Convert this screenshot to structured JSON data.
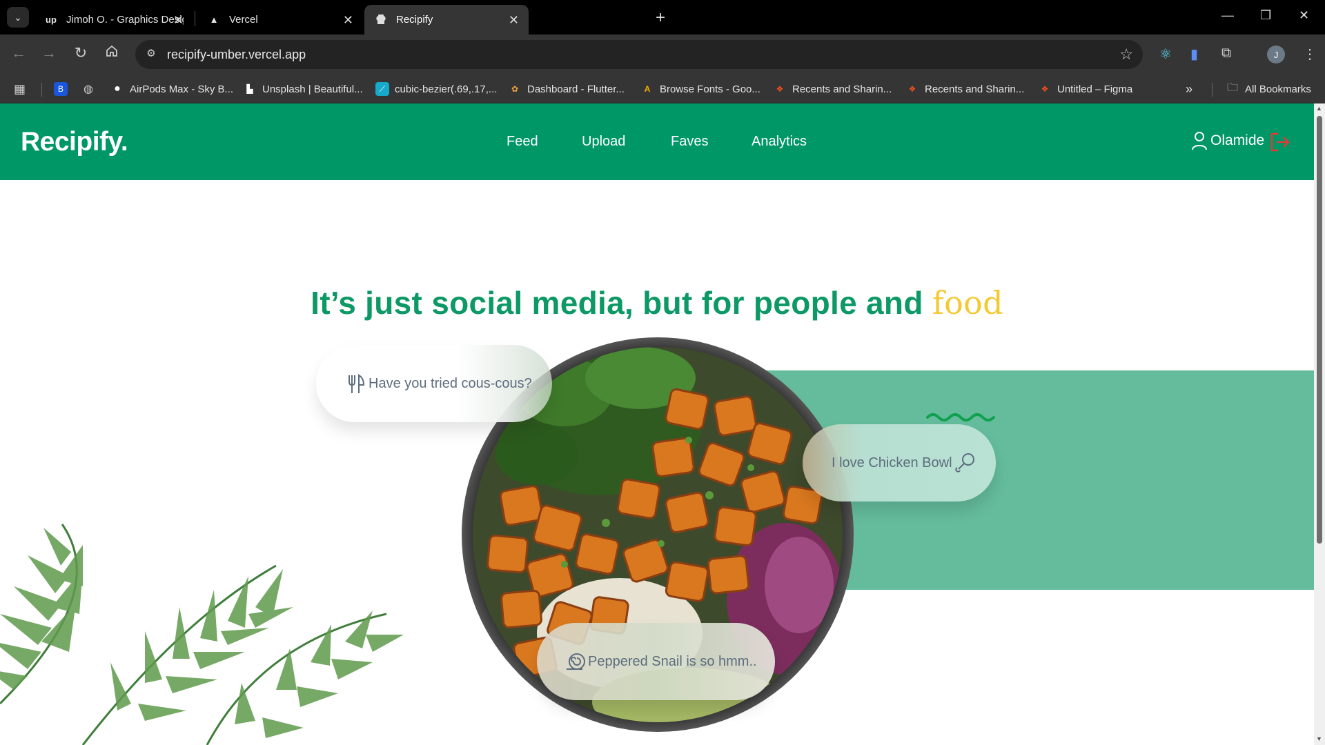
{
  "browser": {
    "tabs": [
      {
        "title": "Jimoh O. - Graphics Designer | U",
        "favicon": "upwork-icon"
      },
      {
        "title": "Vercel",
        "favicon": "vercel-icon"
      },
      {
        "title": "Recipify",
        "favicon": "recipify-icon",
        "active": true
      }
    ],
    "url": "recipify-umber.vercel.app",
    "profile_initial": "J",
    "bookmarks": [
      {
        "label": "AirPods Max - Sky B...",
        "icon": "apple-icon"
      },
      {
        "label": "Unsplash | Beautiful...",
        "icon": "unsplash-icon"
      },
      {
        "label": "cubic-bezier(.69,.17,...",
        "icon": "cubic-bezier-icon"
      },
      {
        "label": "Dashboard - Flutter...",
        "icon": "flutterflow-icon"
      },
      {
        "label": "Browse Fonts - Goo...",
        "icon": "google-fonts-icon"
      },
      {
        "label": "Recents and Sharin...",
        "icon": "figma-icon"
      },
      {
        "label": "Recents and Sharin...",
        "icon": "figma-icon"
      },
      {
        "label": "Untitled – Figma",
        "icon": "figma-icon"
      }
    ],
    "all_bookmarks_label": "All Bookmarks",
    "more_bookmarks": "»"
  },
  "site": {
    "logo": "Recipify.",
    "nav": [
      "Feed",
      "Upload",
      "Faves",
      "Analytics"
    ],
    "user_name": "Olamide"
  },
  "hero": {
    "title_main": "It’s just social media, but for people and",
    "title_accent": "food",
    "bubbles": [
      {
        "text": "Have you tried cous-cous?",
        "icon": "fork-knife-icon"
      },
      {
        "text": "I love Chicken Bowl",
        "icon": "drumstick-icon"
      },
      {
        "text": "Peppered Snail is so hmm..",
        "icon": "snail-icon"
      }
    ]
  },
  "colors": {
    "brand_green": "#009766",
    "band_green": "#64bc9d",
    "accent_yellow": "#f5c932",
    "logout_red": "#e53935"
  }
}
